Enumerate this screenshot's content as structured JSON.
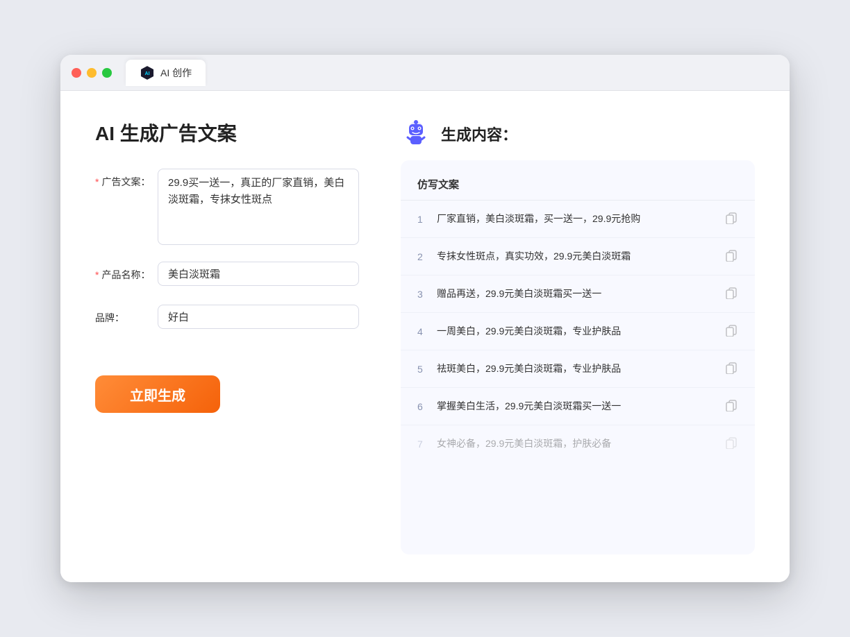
{
  "browser": {
    "tab_label": "AI 创作"
  },
  "page": {
    "title": "AI 生成广告文案",
    "right_title": "生成内容："
  },
  "form": {
    "ad_label": "广告文案：",
    "ad_required": true,
    "ad_value": "29.9买一送一，真正的厂家直销，美白淡斑霜，专抹女性斑点",
    "product_label": "产品名称：",
    "product_required": true,
    "product_value": "美白淡斑霜",
    "brand_label": "品牌：",
    "brand_required": false,
    "brand_value": "好白",
    "generate_btn": "立即生成"
  },
  "results": {
    "column_header": "仿写文案",
    "items": [
      {
        "num": 1,
        "text": "厂家直销，美白淡斑霜，买一送一，29.9元抢购",
        "faded": false
      },
      {
        "num": 2,
        "text": "专抹女性斑点，真实功效，29.9元美白淡斑霜",
        "faded": false
      },
      {
        "num": 3,
        "text": "赠品再送，29.9元美白淡斑霜买一送一",
        "faded": false
      },
      {
        "num": 4,
        "text": "一周美白，29.9元美白淡斑霜，专业护肤品",
        "faded": false
      },
      {
        "num": 5,
        "text": "祛斑美白，29.9元美白淡斑霜，专业护肤品",
        "faded": false
      },
      {
        "num": 6,
        "text": "掌握美白生活，29.9元美白淡斑霜买一送一",
        "faded": false
      },
      {
        "num": 7,
        "text": "女神必备，29.9元美白淡斑霜，护肤必备",
        "faded": true
      }
    ]
  }
}
